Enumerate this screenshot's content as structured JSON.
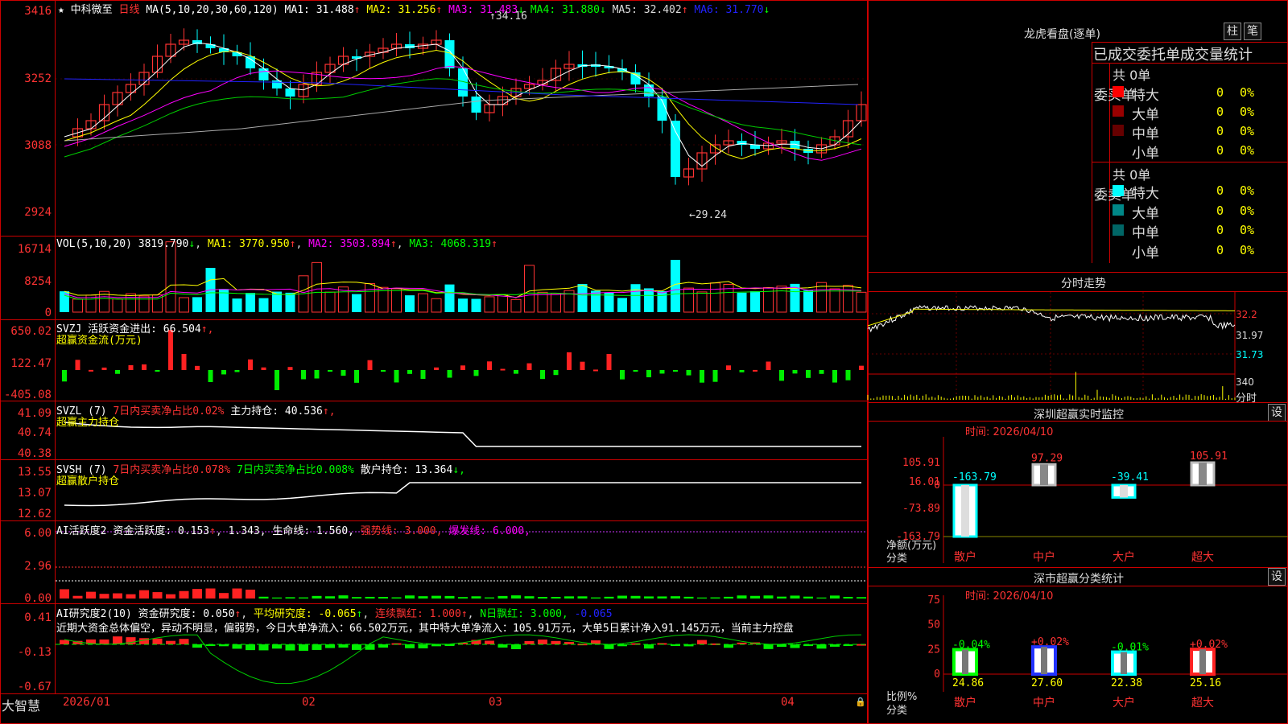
{
  "main": {
    "star_icon": "★",
    "stock_name": "中科微至",
    "period": "日线",
    "ma_params": "MA(5,10,20,30,60,120)",
    "ma": [
      {
        "label": "MA1:",
        "value": "31.488",
        "arrow": "↑",
        "color": "#ffffff"
      },
      {
        "label": "MA2:",
        "value": "31.256",
        "arrow": "↑",
        "color": "#ffff00"
      },
      {
        "label": "MA3:",
        "value": "31.483",
        "arrow": "↓",
        "color": "#ff00ff"
      },
      {
        "label": "MA4:",
        "value": "31.880",
        "arrow": "↓",
        "color": "#00ff00"
      },
      {
        "label": "MA5:",
        "value": "32.402",
        "arrow": "↑",
        "color": "#dddddd"
      },
      {
        "label": "MA6:",
        "value": "31.770",
        "arrow": "↓",
        "color": "#0000ff"
      }
    ],
    "yticks": [
      "3416",
      "3252",
      "3088",
      "2924"
    ],
    "high_label": "34.16",
    "low_label": "←29.24"
  },
  "vol": {
    "params": "VOL(5,10,20)",
    "value": "3819.790",
    "value_arrow": "↓",
    "ma": [
      {
        "label": "MA1:",
        "value": "3770.950",
        "arrow": "↑",
        "color": "#ffffff"
      },
      {
        "label": "MA2:",
        "value": "3503.894",
        "arrow": "↑",
        "color": "#ff00ff"
      },
      {
        "label": "MA3:",
        "value": "4068.319",
        "arrow": "↑",
        "color": "#00ff00"
      }
    ],
    "yticks": [
      "16714",
      "8254",
      "0"
    ]
  },
  "svzj": {
    "name": "SVZJ",
    "text": "活跃资金进出:",
    "value": "66.504",
    "arrow": "↑,",
    "sub": "超赢资金流(万元)",
    "yticks": [
      "650.02",
      "122.47",
      "-405.08"
    ]
  },
  "svzl": {
    "name": "SVZL (7)",
    "red_text": "7日内买卖净占比0.02%",
    "label": "主力持仓:",
    "value": "40.536",
    "arrow": "↑,",
    "sub": "超赢主力持仓",
    "yticks": [
      "41.09",
      "40.74",
      "40.38"
    ]
  },
  "svsh": {
    "name": "SVSH (7)",
    "red_text": "7日内买卖净占比0.078%",
    "green_text": "7日内买卖净占比0.008%",
    "label": "散户持仓:",
    "value": "13.364",
    "arrow": "↓,",
    "sub": "超赢散户持仓",
    "yticks": [
      "13.55",
      "13.07",
      "12.62"
    ]
  },
  "ai1": {
    "name": "AI活跃度2",
    "label": "资金活跃度:",
    "v1": "0.153",
    "v2": "1.343,",
    "life_label": "生命线:",
    "life": "1.560,",
    "strong": "强势线: 3.000,",
    "burst": "爆发线: 6.000,",
    "yticks": [
      "6.00",
      "2.96",
      "0.00"
    ]
  },
  "ai2": {
    "name": "AI研究度2(10)",
    "label": "资金研究度:",
    "v1": "0.050",
    "avg": "平均研究度: -0.065",
    "red": "连续飘红: 1.000",
    "n": "N日飘红: 3.000,",
    "last": "-0.065",
    "comment": "近期大资金总体偏空，异动不明显，偏弱势，今日大单净流入：66.502万元，其中特大单净流入：105.91万元，大单5日累计净入91.145万元，当前主力控盘",
    "yticks": [
      "0.41",
      "-0.13",
      "-0.67"
    ]
  },
  "xaxis": {
    "labels": [
      "2026/01",
      "02",
      "03",
      "04"
    ],
    "brand": "大智慧"
  },
  "right": {
    "title": "龙虎看盘(逐单)",
    "btn_bar": "柱",
    "btn_pen": "笔",
    "subtitle": "已成交委托单成交量统计",
    "buy": {
      "side_label": "委买单",
      "total": "共 0单",
      "rows": [
        {
          "label": "特大",
          "color": "#ff0000",
          "v1": "0",
          "v2": "0%"
        },
        {
          "label": "大单",
          "color": "#990000",
          "v1": "0",
          "v2": "0%"
        },
        {
          "label": "中单",
          "color": "#660000",
          "v1": "0",
          "v2": "0%"
        },
        {
          "label": "小单",
          "color": "",
          "v1": "0",
          "v2": "0%"
        }
      ]
    },
    "sell": {
      "side_label": "委卖单",
      "total": "共 0单",
      "rows": [
        {
          "label": "特大",
          "color": "#00ffff",
          "v1": "0",
          "v2": "0%"
        },
        {
          "label": "大单",
          "color": "#008888",
          "v1": "0",
          "v2": "0%"
        },
        {
          "label": "中单",
          "color": "#006666",
          "v1": "0",
          "v2": "0%"
        },
        {
          "label": "小单",
          "color": "",
          "v1": "0",
          "v2": "0%"
        }
      ]
    },
    "intraday": {
      "title": "分时走势",
      "yticks": [
        "32.2",
        "31.97",
        "31.73",
        "340"
      ],
      "bottom_label": "分时"
    },
    "monitor": {
      "title": "深圳超赢实时监控",
      "btn": "设",
      "time": "时间: 2026/04/10",
      "yticks": [
        "105.91",
        "16.01",
        "0",
        "-73.89",
        "-163.79"
      ],
      "side_label_1": "净额(万元)",
      "side_label_2": "分类",
      "bars": [
        {
          "cat": "散户",
          "value": -163.79,
          "label": "-163.79"
        },
        {
          "cat": "中户",
          "value": 97.29,
          "label": "97.29"
        },
        {
          "cat": "大户",
          "value": -39.41,
          "label": "-39.41"
        },
        {
          "cat": "超大",
          "value": 105.91,
          "label": "105.91"
        }
      ]
    },
    "classify": {
      "title": "深市超赢分类统计",
      "btn": "设",
      "time": "时间: 2026/04/10",
      "yticks": [
        "75",
        "50",
        "25",
        "0"
      ],
      "side_label_1": "比例%",
      "side_label_2": "分类",
      "bars": [
        {
          "cat": "散户",
          "value": 24.86,
          "label": "24.86",
          "change": "-0.04%",
          "change_color": "#00ff00",
          "color": "#00ff00"
        },
        {
          "cat": "中户",
          "value": 27.6,
          "label": "27.60",
          "change": "+0.02%",
          "change_color": "#ff3333",
          "color": "#2233ff"
        },
        {
          "cat": "大户",
          "value": 22.38,
          "label": "22.38",
          "change": "-0.01%",
          "change_color": "#00ff00",
          "color": "#00ffff"
        },
        {
          "cat": "超大",
          "value": 25.16,
          "label": "25.16",
          "change": "+0.02%",
          "change_color": "#ff3333",
          "color": "#ff2222"
        }
      ]
    }
  }
}
